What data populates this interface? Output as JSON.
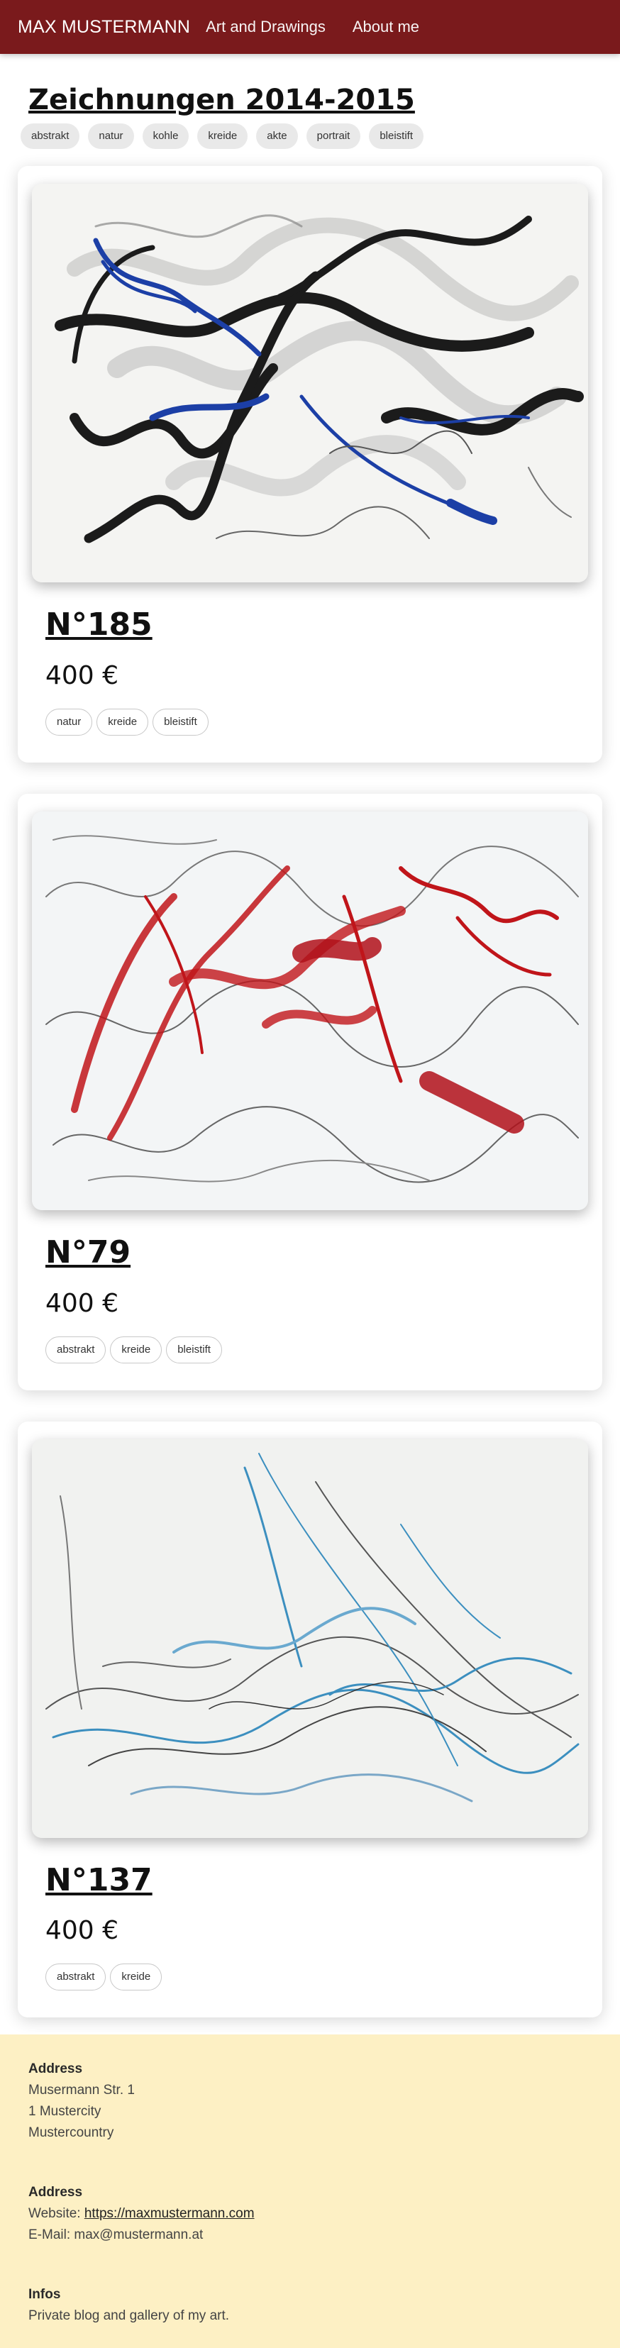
{
  "nav": {
    "brand": "MAX MUSTERMANN",
    "links": [
      "Art and Drawings",
      "About me"
    ]
  },
  "gallery": {
    "title": "Zeichnungen 2014-2015",
    "filters": [
      "abstrakt",
      "natur",
      "kohle",
      "kreide",
      "akte",
      "portrait",
      "bleistift"
    ]
  },
  "artworks": [
    {
      "title": "N°185",
      "price": "400 €",
      "tags": [
        "natur",
        "kreide",
        "bleistift"
      ]
    },
    {
      "title": "N°79",
      "price": "400 €",
      "tags": [
        "abstrakt",
        "kreide",
        "bleistift"
      ]
    },
    {
      "title": "N°137",
      "price": "400 €",
      "tags": [
        "abstrakt",
        "kreide"
      ]
    }
  ],
  "footer": {
    "address": {
      "heading": "Address",
      "lines": [
        "Musermann Str. 1",
        "1 Mustercity",
        "Mustercountry"
      ]
    },
    "contact": {
      "heading": "Address",
      "website_label": "Website: ",
      "website": "https://maxmustermann.com",
      "email": "E-Mail: max@mustermann.at"
    },
    "infos": {
      "heading": "Infos",
      "text": "Private blog and gallery of my art."
    }
  },
  "colors": {
    "navbar": "#7a1a1c",
    "footer": "#fdf0c4",
    "chip": "#e9e9e9"
  }
}
